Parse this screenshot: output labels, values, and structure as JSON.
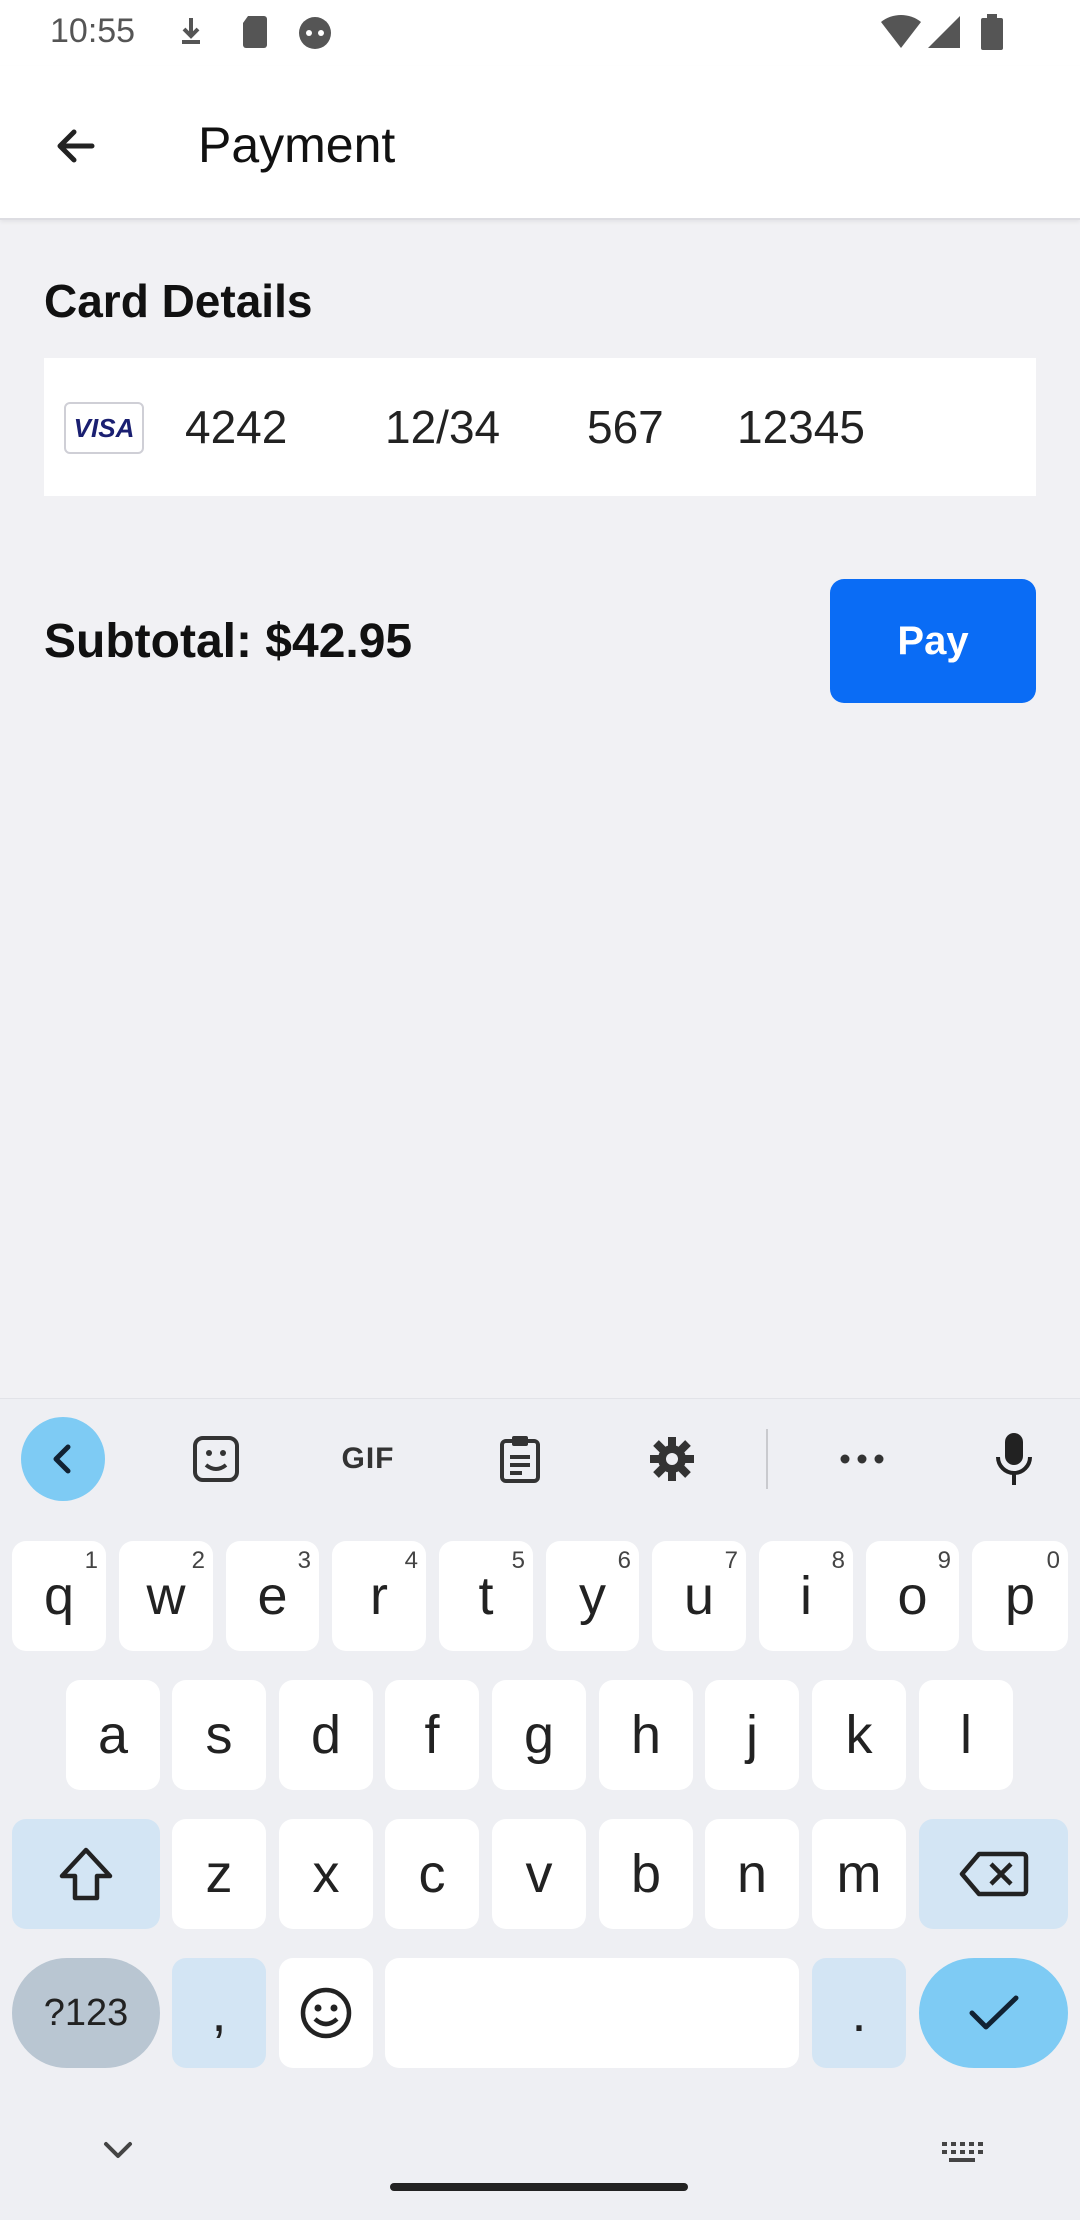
{
  "status_bar": {
    "time": "10:55"
  },
  "app_bar": {
    "title": "Payment",
    "back_icon": "arrow-back-icon"
  },
  "card_details": {
    "title": "Card Details",
    "brand_logo": "VISA",
    "card_number": "4242",
    "expiry": "12/34",
    "cvc": "567",
    "zip": "12345"
  },
  "order": {
    "subtotal_label": "Subtotal: $42.95",
    "pay_label": "Pay"
  },
  "keyboard": {
    "toolbar": {
      "gif_label": "GIF"
    },
    "row1": [
      {
        "k": "q",
        "h": "1"
      },
      {
        "k": "w",
        "h": "2"
      },
      {
        "k": "e",
        "h": "3"
      },
      {
        "k": "r",
        "h": "4"
      },
      {
        "k": "t",
        "h": "5"
      },
      {
        "k": "y",
        "h": "6"
      },
      {
        "k": "u",
        "h": "7"
      },
      {
        "k": "i",
        "h": "8"
      },
      {
        "k": "o",
        "h": "9"
      },
      {
        "k": "p",
        "h": "0"
      }
    ],
    "row2": [
      "a",
      "s",
      "d",
      "f",
      "g",
      "h",
      "j",
      "k",
      "l"
    ],
    "row3": [
      "z",
      "x",
      "c",
      "v",
      "b",
      "n",
      "m"
    ],
    "symbols_label": "?123",
    "comma": ",",
    "period": "."
  }
}
